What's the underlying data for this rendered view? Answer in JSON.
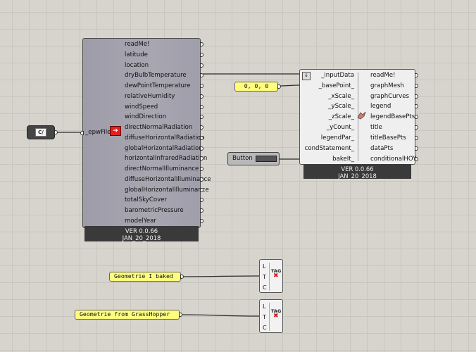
{
  "epw_component": {
    "input_label": "_epwFile",
    "outputs": [
      "readMe!",
      "latitude",
      "location",
      "dryBulbTemperature",
      "dewPointTemperature",
      "relativeHumidity",
      "windSpeed",
      "windDirection",
      "directNormalRadiation",
      "diffuseHorizontalRadiation",
      "globalHorizontalRadiation",
      "horizontalInfraredRadiation",
      "directNormalIlluminance",
      "diffuseHorizontalIlluminance",
      "globalHorizontalIlluminance",
      "totalSkyCover",
      "barometricPressure",
      "modelYear"
    ],
    "version": "VER 0.0.66",
    "date": "JAN_20_2018"
  },
  "graph_component": {
    "inputs": [
      "_inputData",
      "_basePoint_",
      "_xScale_",
      "_yScale_",
      "_zScale_",
      "_yCount_",
      "legendPar_",
      "condStatement_",
      "bakeIt_"
    ],
    "outputs": [
      "readMe!",
      "graphMesh",
      "graphCurves",
      "legend",
      "legendBasePts",
      "title",
      "titleBasePts",
      "dataPts",
      "conditionalHOY"
    ],
    "version": "VER 0.0.66",
    "date": "JAN_20_2018"
  },
  "point_panel": {
    "text": "0, 0, 0"
  },
  "button": {
    "label": "Button"
  },
  "path_param": {
    "icon_text": "C/"
  },
  "bake_panels": [
    {
      "text": "Geometrie I baked"
    },
    {
      "text": "Geometrie from GrassHopper"
    }
  ],
  "bake_component": {
    "pins": [
      "L",
      "T",
      "C"
    ],
    "tag_label": "TAG"
  },
  "colors": {
    "canvas": "#d6d4cc",
    "panel_yellow": "#fefd7e",
    "error_red": "#e02020"
  }
}
